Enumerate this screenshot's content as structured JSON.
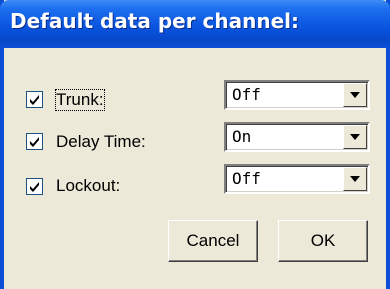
{
  "dialog": {
    "title": "Default data per channel:"
  },
  "rows": [
    {
      "label": "Trunk:",
      "checked": true,
      "value": "Off"
    },
    {
      "label": "Delay Time:",
      "checked": true,
      "value": "On"
    },
    {
      "label": "Lockout:",
      "checked": true,
      "value": "Off"
    }
  ],
  "buttons": {
    "cancel": "Cancel",
    "ok": "OK"
  }
}
